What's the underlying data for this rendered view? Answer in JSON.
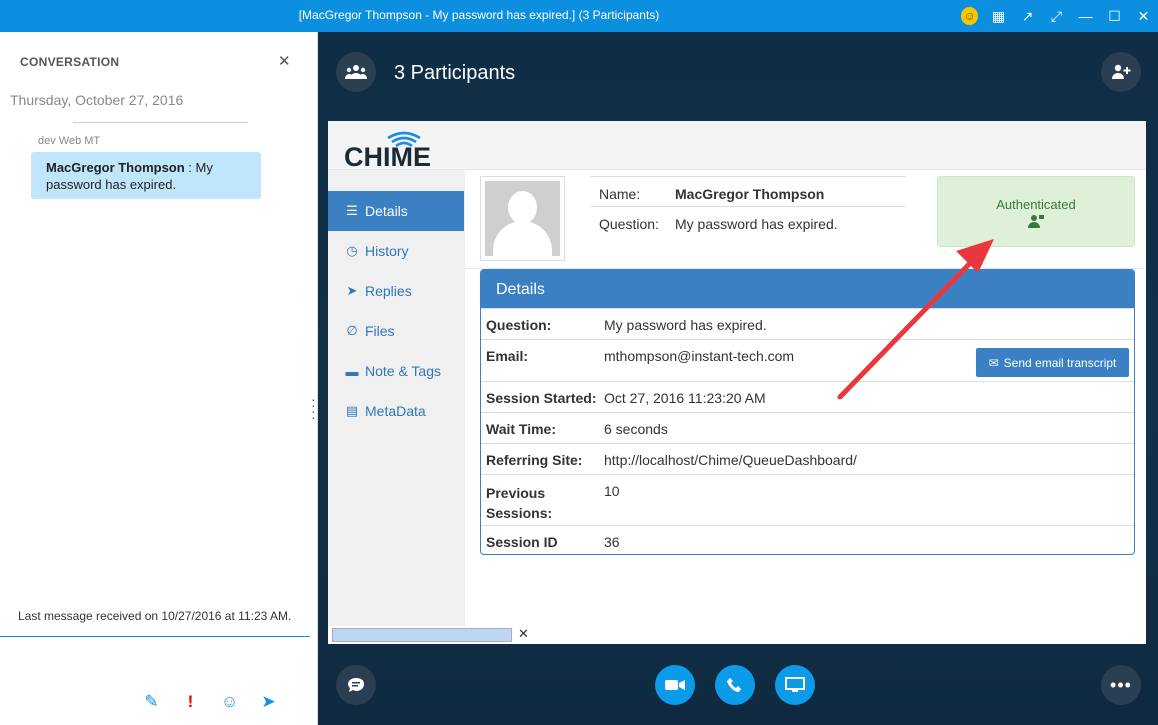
{
  "window": {
    "title": "[MacGregor Thompson - My password has expired.] (3 Participants)"
  },
  "conversation": {
    "header": "CONVERSATION",
    "date": "Thursday, October 27, 2016",
    "sender": "dev Web MT",
    "message_author": "MacGregor Thompson",
    "message_text": " : My password has expired.",
    "last_message": "Last message received on 10/27/2016 at 11:23 AM."
  },
  "main": {
    "participants_label": "3 Participants"
  },
  "chime": {
    "logo_text": "CHIME",
    "sidebar": [
      {
        "label": "Details",
        "icon": "list-icon",
        "active": true
      },
      {
        "label": "History",
        "icon": "history-icon"
      },
      {
        "label": "Replies",
        "icon": "send-icon"
      },
      {
        "label": "Files",
        "icon": "paperclip-icon"
      },
      {
        "label": "Note & Tags",
        "icon": "comment-icon"
      },
      {
        "label": "MetaData",
        "icon": "list-alt-icon"
      }
    ],
    "name_label": "Name:",
    "name_value": "MacGregor Thompson",
    "question_label": "Question:",
    "question_value": "My password has expired.",
    "auth_label": "Authenticated",
    "details_title": "Details",
    "details_rows": [
      {
        "key": "Question:",
        "value": "My password has expired."
      },
      {
        "key": "Email:",
        "value": "mthompson@instant-tech.com"
      },
      {
        "key": "Session Started:",
        "value": "Oct 27, 2016 11:23:20 AM"
      },
      {
        "key": "Wait Time:",
        "value": "6 seconds"
      },
      {
        "key": "Referring Site:",
        "value": "http://localhost/Chime/QueueDashboard/"
      },
      {
        "key": "Previous Sessions:",
        "value": "10"
      },
      {
        "key": "Session ID",
        "value": "36"
      }
    ],
    "email_button": "Send email transcript"
  },
  "colors": {
    "titlebar": "#0d8fe0",
    "accent": "#3a80c3",
    "auth_bg": "#dff0d8",
    "arrow": "#e8383d",
    "call_button": "#0b9be8"
  }
}
